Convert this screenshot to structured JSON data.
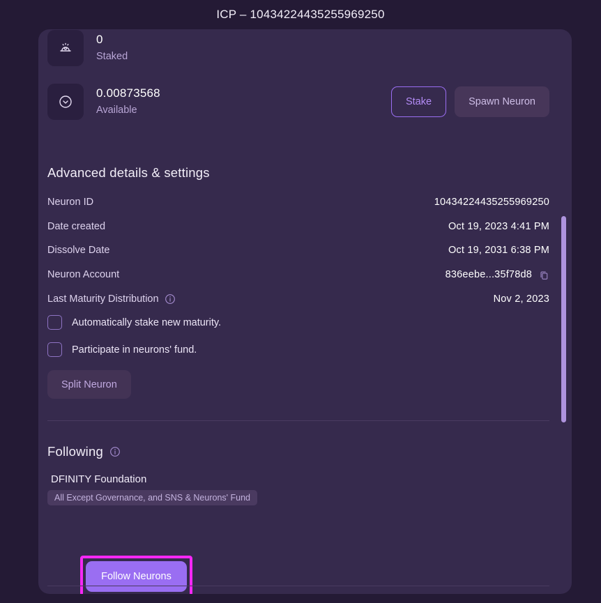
{
  "page": {
    "title": "ICP – 10434224435255969250"
  },
  "balances": [
    {
      "icon": "staked-icon",
      "amount": "0",
      "label": "Staked"
    },
    {
      "icon": "available-icon",
      "amount": "0.00873568",
      "label": "Available"
    }
  ],
  "actions": {
    "stake_label": "Stake",
    "spawn_label": "Spawn Neuron"
  },
  "advanced": {
    "heading": "Advanced details & settings",
    "rows": [
      {
        "label": "Neuron ID",
        "value": "10434224435255969250"
      },
      {
        "label": "Date created",
        "value": "Oct 19, 2023 4:41 PM"
      },
      {
        "label": "Dissolve Date",
        "value": "Oct 19, 2031 6:38 PM"
      },
      {
        "label": "Neuron Account",
        "value": "836eebe...35f78d8"
      },
      {
        "label": "Last Maturity Distribution",
        "value": "Nov 2, 2023"
      }
    ],
    "checkboxes": [
      {
        "label": "Automatically stake new maturity.",
        "checked": false
      },
      {
        "label": "Participate in neurons' fund.",
        "checked": false
      }
    ],
    "split_label": "Split Neuron"
  },
  "following": {
    "heading": "Following",
    "entry_name": "DFINITY Foundation",
    "entry_topics": "All Except Governance, and SNS & Neurons' Fund",
    "follow_label": "Follow Neurons"
  },
  "colors": {
    "page_bg": "#241a35",
    "card_bg": "#362a4d",
    "accent_purple": "#9a6ef2",
    "highlight_magenta": "#f627f6",
    "muted_text": "#b9a6d6"
  }
}
